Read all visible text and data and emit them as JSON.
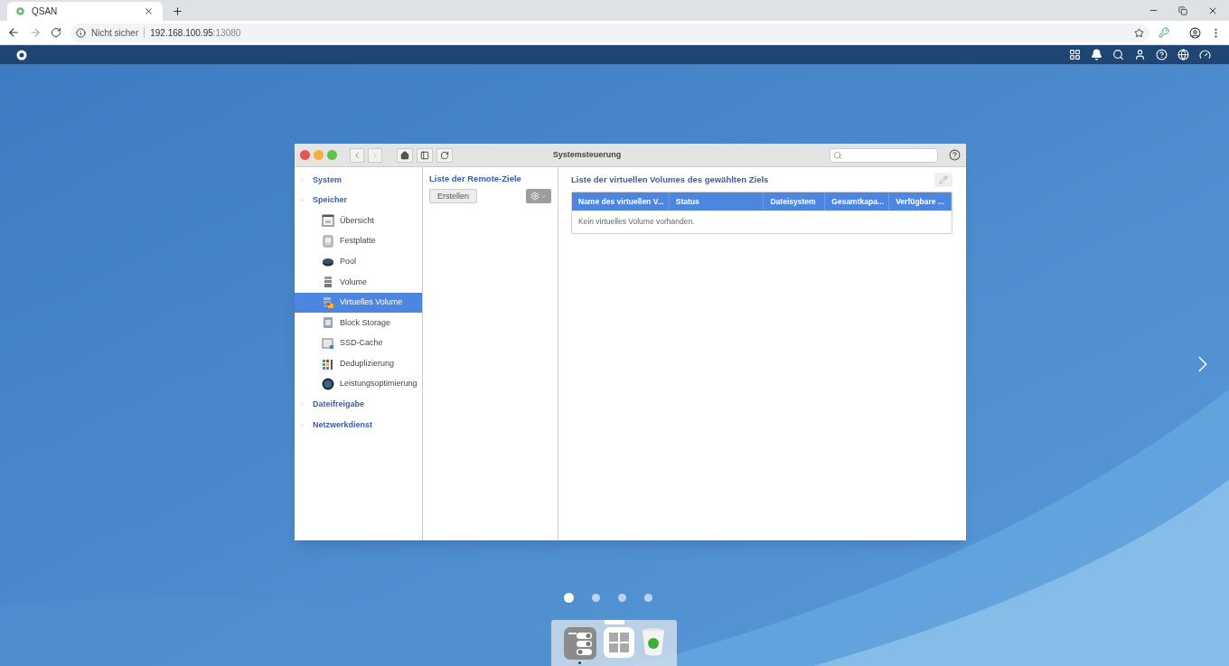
{
  "browser": {
    "tab_title": "QSAN",
    "security": "Nicht sicher",
    "host": "192.168.100.95",
    "port": ":13080"
  },
  "window": {
    "title": "Systemsteuerung"
  },
  "sidebar": {
    "items": [
      {
        "label": "System",
        "expanded": false
      },
      {
        "label": "Speicher",
        "expanded": true,
        "children": [
          {
            "label": "Übersicht",
            "selected": false
          },
          {
            "label": "Festplatte",
            "selected": false
          },
          {
            "label": "Pool",
            "selected": false
          },
          {
            "label": "Volume",
            "selected": false
          },
          {
            "label": "Virtuelles Volume",
            "selected": true
          },
          {
            "label": "Block Storage",
            "selected": false
          },
          {
            "label": "SSD-Cache",
            "selected": false
          },
          {
            "label": "Deduplizierung",
            "selected": false
          },
          {
            "label": "Leistungsoptimierung",
            "selected": false
          }
        ]
      },
      {
        "label": "Dateifreigabe",
        "expanded": false
      },
      {
        "label": "Netzwerkdienst",
        "expanded": false
      }
    ]
  },
  "remote_panel": {
    "title": "Liste der Remote-Ziele",
    "create_button": "Erstellen"
  },
  "volumes_panel": {
    "title": "Liste der virtuellen Volumes des gewählten Ziels",
    "columns": [
      "Name des virtuellen V...",
      "Status",
      "Dateisystem",
      "Gesamtkapa...",
      "Verfügbare ..."
    ],
    "empty_message": "Kein virtuelles Volume vorhanden."
  },
  "pager": [
    {
      "selected": true
    },
    {
      "selected": false
    },
    {
      "selected": false
    },
    {
      "selected": false
    }
  ],
  "dock": [
    {
      "kind": "settings",
      "selected": true
    },
    {
      "kind": "apps",
      "selected": false
    },
    {
      "kind": "trash",
      "selected": false
    }
  ]
}
